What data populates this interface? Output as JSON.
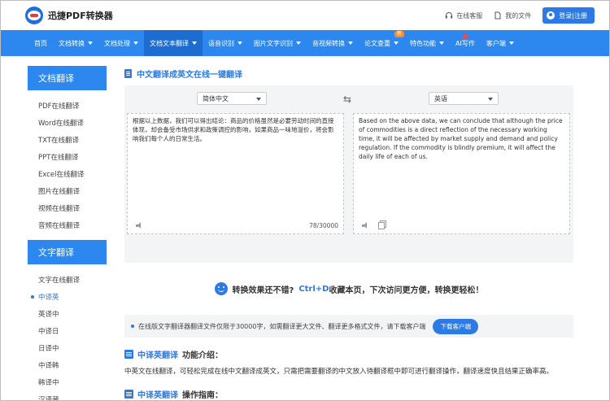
{
  "header": {
    "logo_text": "迅捷PDF转换器",
    "service_label": "在线客服",
    "files_label": "我的文件",
    "login_label": "登录|注册"
  },
  "nav": {
    "items": [
      {
        "label": "首页"
      },
      {
        "label": "文档转换"
      },
      {
        "label": "文档处理"
      },
      {
        "label": "文档文本翻译"
      },
      {
        "label": "语音识别"
      },
      {
        "label": "图片文字识别"
      },
      {
        "label": "音视频转换"
      },
      {
        "label": "论文查重"
      },
      {
        "label": "特色功能"
      },
      {
        "label": "AI写作"
      },
      {
        "label": "客户端"
      }
    ],
    "new_badge": "新"
  },
  "sidebar": {
    "group1_title": "文档翻译",
    "group1": [
      "PDF在线翻译",
      "Word在线翻译",
      "TXT在线翻译",
      "PPT在线翻译",
      "Excel在线翻译",
      "图片在线翻译",
      "视频在线翻译",
      "音频在线翻译"
    ],
    "group2_title": "文字翻译",
    "group2": [
      "文字在线翻译",
      "中译英",
      "英译中",
      "中译日",
      "日译中",
      "中译韩",
      "韩译中",
      "汉译藏"
    ]
  },
  "main": {
    "title": "中文翻译成英文在线一键翻译",
    "source_lang": "简体中文",
    "target_lang": "英语",
    "source_text": "根据以上数据，我们可以得出结论：商品的价格虽然是必要劳动时间的直接体现，却会备受市场供求和政策调控的影响，如果商品一味地溢价，将会影响我们每个人的日常生活。",
    "target_text": "Based on the above data, we can conclude that although the price of commodities is a direct reflection of the necessary working time, it will be affected by market supply and demand and policy regulation. If the commodity is blindly premium, it will affect the daily life of each of us.",
    "char_count": "78/30000",
    "promo_prefix": "转换效果还不错?",
    "promo_highlight": "Ctrl+D",
    "promo_suffix": "收藏本页，下次访问更方便，转换更轻松！",
    "notice_text": "在线版文字翻译器翻译文件仅限于30000字，如需翻译更大文件、翻译更多格式文件，请下载客户端",
    "download_label": "下载客户端",
    "intro_title_blue": "中译英翻译",
    "intro_title_dark": "功能介绍：",
    "intro_text": "中英文在线翻译，可轻松完成在线中文翻译成英文，只需把需要翻译的中文放入待翻译框中即可进行翻译操作，翻译速度快且结果正确率高。",
    "guide_title_blue": "中译英翻译",
    "guide_title_dark": "操作指南："
  },
  "colors": {
    "brand_blue": "#2c87ee",
    "accent_blue": "#2b7ae5"
  }
}
